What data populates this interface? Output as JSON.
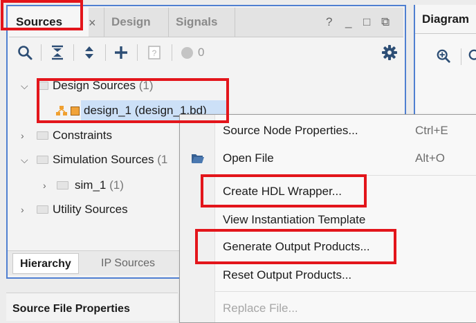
{
  "sources_panel": {
    "tabs": {
      "sources": "Sources",
      "close": "×",
      "design": "Design",
      "signals": "Signals"
    },
    "window_buttons": {
      "help": "?",
      "minimize": "_",
      "maximize": "□",
      "float": "⧉"
    },
    "toolbar": {
      "status_count": "0"
    },
    "tree": {
      "design_sources": {
        "label": "Design Sources",
        "count": "(1)"
      },
      "design_1": {
        "label": "design_1 (design_1.bd)"
      },
      "constraints": {
        "label": "Constraints"
      },
      "simulation_sources": {
        "label": "Simulation Sources",
        "count": "(1"
      },
      "sim_1": {
        "label": "sim_1",
        "count": "(1)"
      },
      "utility_sources": {
        "label": "Utility Sources"
      }
    },
    "bottom_tabs": {
      "hierarchy": "Hierarchy",
      "ip_sources": "IP Sources"
    }
  },
  "source_file_properties": {
    "title": "Source File Properties"
  },
  "diagram_panel": {
    "tab": "Diagram"
  },
  "context_menu": {
    "items": [
      {
        "label": "Source Node Properties...",
        "shortcut": "Ctrl+E"
      },
      {
        "label": "Open File",
        "shortcut": "Alt+O"
      },
      {
        "label": "Create HDL Wrapper...",
        "shortcut": ""
      },
      {
        "label": "View Instantiation Template",
        "shortcut": ""
      },
      {
        "label": "Generate Output Products...",
        "shortcut": ""
      },
      {
        "label": "Reset Output Products...",
        "shortcut": ""
      },
      {
        "label": "Replace File...",
        "shortcut": ""
      }
    ]
  },
  "colors": {
    "highlight_red": "#e3151b",
    "panel_border_blue": "#4f7fd1",
    "selection_blue": "#cce0f7",
    "block_design_orange": "#f0a030"
  }
}
